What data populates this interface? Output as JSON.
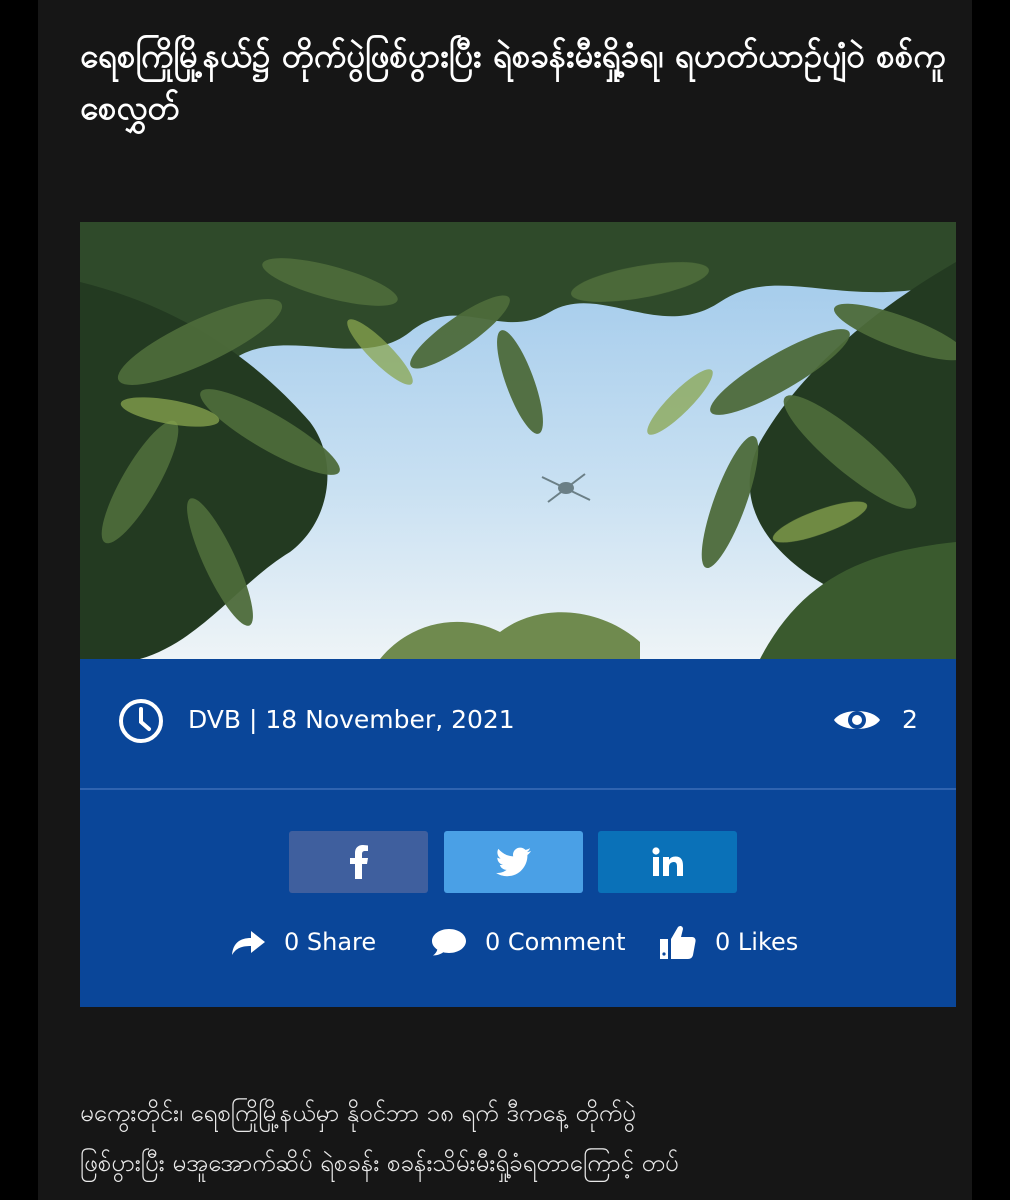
{
  "article": {
    "title": "ရေစကြိုမြို့နယ်၌ တိုက်ပွဲဖြစ်ပွားပြီး ရဲစခန်းမီးရှို့ခံရ၊ ရဟတ်ယာဉ်ပျံဝဲ စစ်ကူစေလွှတ်",
    "image_alt": "tree-canopy-helicopter-photo",
    "meta": {
      "byline": "DVB | 18 November, 2021",
      "views": "2"
    },
    "share_buttons": [
      {
        "network": "facebook",
        "icon": "facebook-icon",
        "color": "#3f5f9e"
      },
      {
        "network": "twitter",
        "icon": "twitter-icon",
        "color": "#4aa0e6"
      },
      {
        "network": "linkedin",
        "icon": "linkedin-icon",
        "color": "#0a71b8"
      }
    ],
    "stats": {
      "share": "0 Share",
      "comment": "0 Comment",
      "likes": "0 Likes"
    },
    "body_lines": [
      "မကွေးတိုင်း၊ ရေစကြိုမြို့နယ်မှာ နိုဝင်ဘာ ၁၈ ရက် ဒီကနေ့ တိုက်ပွဲ",
      "ဖြစ်ပွားပြီး မအူအောက်ဆိပ် ရဲစခန်း စခန်းသိမ်းမီးရှို့ခံရတာကြောင့် တပ်"
    ]
  },
  "colors": {
    "page_bg": "#161616",
    "panel_bg": "#0a4699",
    "text": "#ffffff"
  }
}
